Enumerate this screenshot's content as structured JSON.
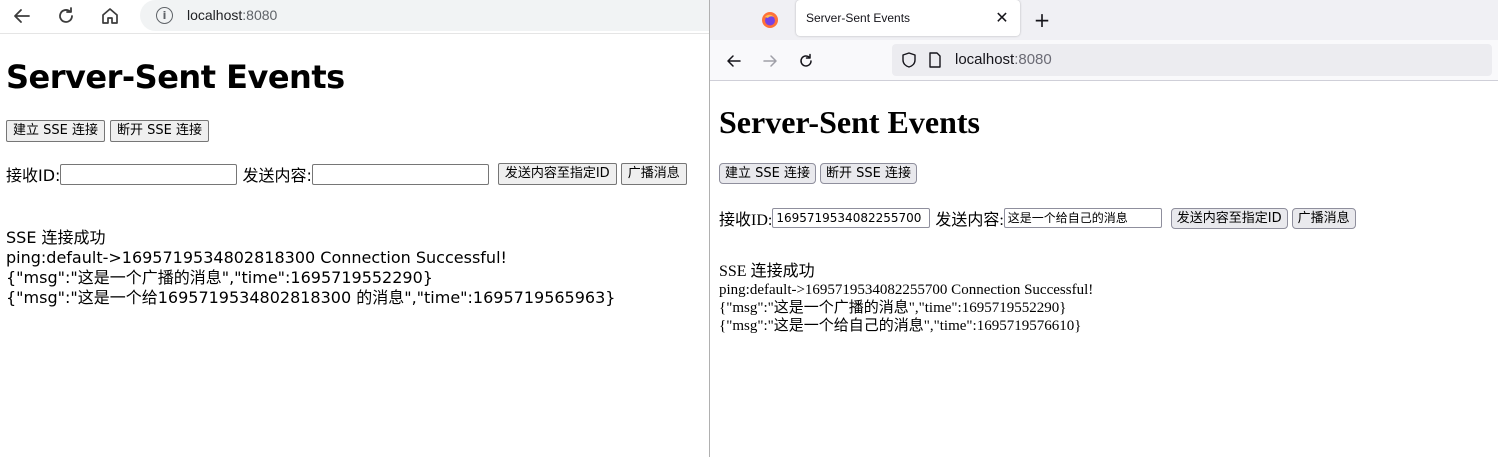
{
  "left": {
    "url": {
      "host": "localhost",
      "port": ":8080"
    },
    "page": {
      "title": "Server-Sent Events",
      "connect_label": "建立 SSE 连接",
      "disconnect_label": "断开 SSE 连接",
      "receiver_label": "接收ID:",
      "receiver_value": "",
      "content_label": "发送内容:",
      "content_value": "",
      "send_to_id_label": "发送内容至指定ID",
      "broadcast_label": "广播消息",
      "log": [
        "SSE 连接成功",
        "ping:default->1695719534802818300 Connection Successful!",
        "{\"msg\":\"这是一个广播的消息\",\"time\":1695719552290}",
        "{\"msg\":\"这是一个给1695719534802818300 的消息\",\"time\":1695719565963}"
      ]
    }
  },
  "right": {
    "tab": {
      "title": "Server-Sent Events"
    },
    "url": {
      "host": "localhost",
      "port": ":8080"
    },
    "page": {
      "title": "Server-Sent Events",
      "connect_label": "建立 SSE 连接",
      "disconnect_label": "断开 SSE 连接",
      "receiver_label": "接收ID:",
      "receiver_value": "1695719534082255700",
      "content_label": "发送内容:",
      "content_value": "这是一个给自己的消息",
      "send_to_id_label": "发送内容至指定ID",
      "broadcast_label": "广播消息",
      "log": [
        "SSE 连接成功",
        "ping:default->1695719534082255700 Connection Successful!",
        "{\"msg\":\"这是一个广播的消息\",\"time\":1695719552290}",
        "{\"msg\":\"这是一个给自己的消息\",\"time\":1695719576610}"
      ]
    }
  }
}
